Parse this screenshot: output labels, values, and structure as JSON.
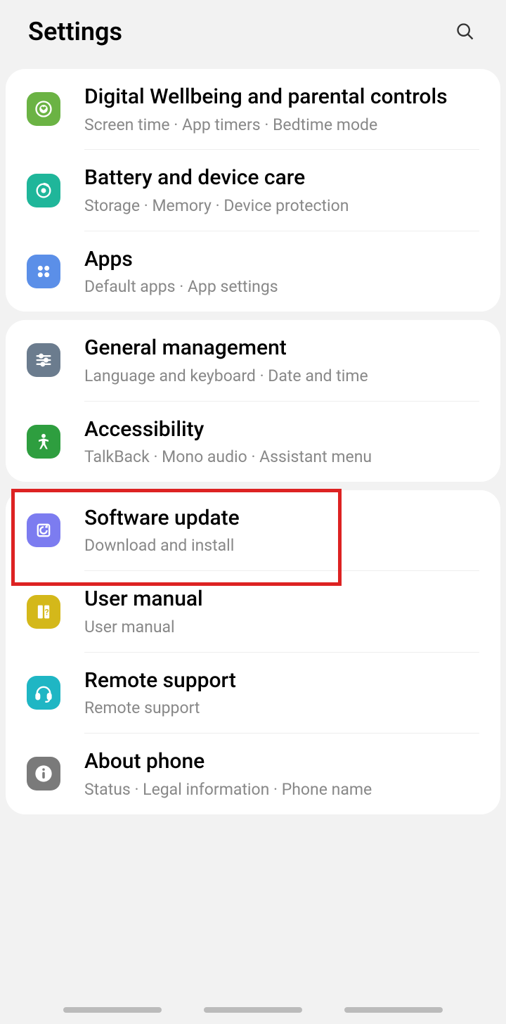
{
  "header": {
    "title": "Settings"
  },
  "groups": [
    {
      "items": [
        {
          "icon": "wellbeing",
          "title": "Digital Wellbeing and parental controls",
          "subtitle": "Screen time  ·  App timers  ·  Bedtime mode"
        },
        {
          "icon": "battery",
          "title": "Battery and device care",
          "subtitle": "Storage  ·  Memory  ·  Device protection"
        },
        {
          "icon": "apps",
          "title": "Apps",
          "subtitle": "Default apps  ·  App settings"
        }
      ]
    },
    {
      "items": [
        {
          "icon": "general",
          "title": "General management",
          "subtitle": "Language and keyboard  ·  Date and time"
        },
        {
          "icon": "accessibility",
          "title": "Accessibility",
          "subtitle": "TalkBack  ·  Mono audio  ·  Assistant menu"
        }
      ]
    },
    {
      "items": [
        {
          "icon": "software",
          "title": "Software update",
          "subtitle": "Download and install",
          "highlighted": true
        },
        {
          "icon": "manual",
          "title": "User manual",
          "subtitle": "User manual"
        },
        {
          "icon": "remote",
          "title": "Remote support",
          "subtitle": "Remote support"
        },
        {
          "icon": "about",
          "title": "About phone",
          "subtitle": "Status  ·  Legal information  ·  Phone name"
        }
      ]
    }
  ]
}
